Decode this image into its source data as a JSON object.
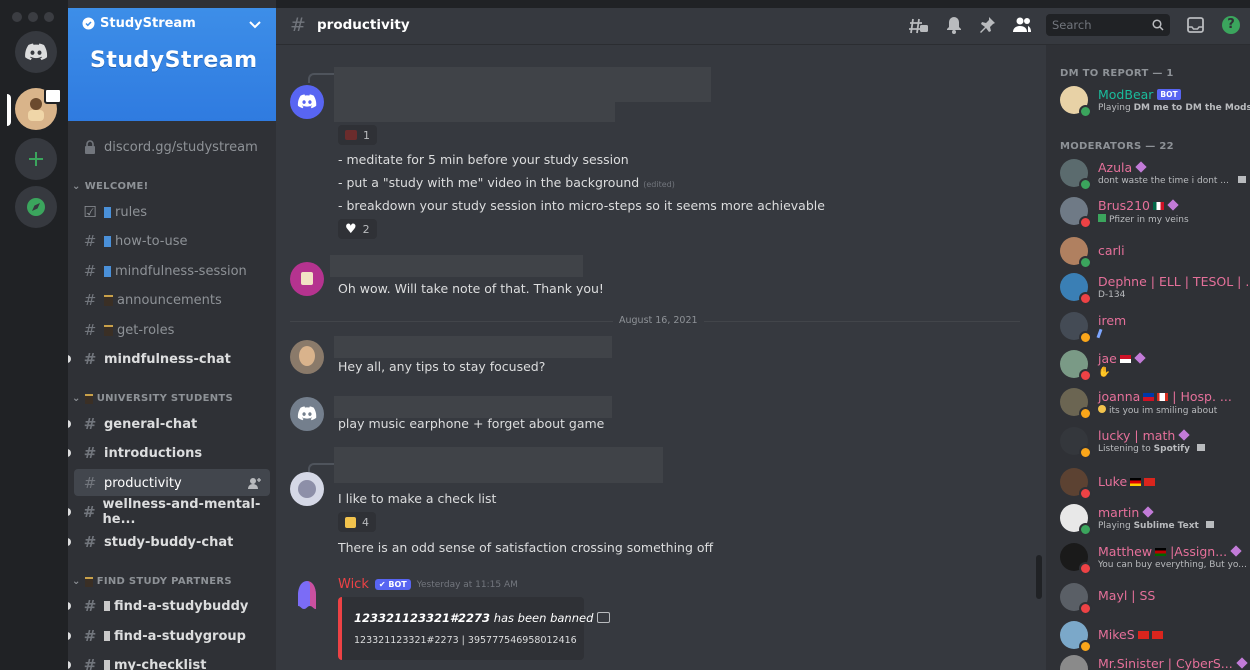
{
  "server": {
    "name": "StudyStream",
    "banner_text": "StudyStream",
    "invite": "discord.gg/studystream"
  },
  "sidebar": {
    "categories": [
      {
        "label": "WELCOME!"
      },
      {
        "label": "UNIVERSITY STUDENTS"
      },
      {
        "label": "FIND STUDY PARTNERS"
      }
    ],
    "channels": [
      {
        "label": "rules"
      },
      {
        "label": "how-to-use"
      },
      {
        "label": "mindfulness-session"
      },
      {
        "label": "announcements"
      },
      {
        "label": "get-roles"
      },
      {
        "label": "mindfulness-chat"
      },
      {
        "label": "general-chat"
      },
      {
        "label": "introductions"
      },
      {
        "label": "productivity"
      },
      {
        "label": "wellness-and-mental-he..."
      },
      {
        "label": "study-buddy-chat"
      },
      {
        "label": "find-a-studybuddy"
      },
      {
        "label": "find-a-studygroup"
      },
      {
        "label": "my-checklist"
      }
    ]
  },
  "header": {
    "channel": "productivity",
    "search_placeholder": "Search"
  },
  "messages": {
    "m1": {
      "reaction_count": "1",
      "lines": [
        "- meditate for 5 min before your study session",
        "- put a \"study with me\" video in the background",
        "- breakdown your study session into micro-steps so it seems more achievable"
      ],
      "edited": "(edited)",
      "heart_count": "2"
    },
    "m2": "Oh wow. Will take note of that. Thank you!",
    "date_divider": "August 16, 2021",
    "m3": "Hey all, any tips to stay focused?",
    "m4": "play music earphone + forget about game",
    "m5": {
      "text": "I like to make a check list",
      "thumbs_count": "4",
      "text2": "There is an odd sense of satisfaction crossing something off"
    },
    "m6": {
      "author": "Wick",
      "bot_tag": "BOT",
      "timestamp": "Yesterday at 11:15 AM",
      "embed_title_id": "123321123321#2273",
      "embed_title_rest": "has been banned",
      "embed_sub": "123321123321#2273 | 395777546958012416"
    }
  },
  "members": {
    "dm_header": "DM TO REPORT — 1",
    "mod_header": "MODERATORS — 22",
    "list": [
      {
        "name": "ModBear",
        "tag": "BOT",
        "sub_pre": "Playing ",
        "sub_bold": "DM me to DM the Mods"
      },
      {
        "name": "Azula",
        "sub": "dont waste the time i dont ..."
      },
      {
        "name": "Brus210",
        "sub": "Pfizer in my veins"
      },
      {
        "name": "carli"
      },
      {
        "name": "Dephne | ELL | TESOL | ...",
        "sub": "D-134"
      },
      {
        "name": "irem"
      },
      {
        "name": "jae"
      },
      {
        "name": "joanna",
        "name_rest": "| Hosp. ...",
        "sub": "its you im smiling about"
      },
      {
        "name": "lucky | math",
        "sub_pre": "Listening to ",
        "sub_bold": "Spotify"
      },
      {
        "name": "Luke"
      },
      {
        "name": "martin",
        "sub_pre": "Playing ",
        "sub_bold": "Sublime Text"
      },
      {
        "name": "Matthew",
        "name_rest": "|Assign...",
        "sub": "You can buy everything, But yo..."
      },
      {
        "name": "Mayl | SS"
      },
      {
        "name": "MikeS"
      },
      {
        "name": "Mr.Sinister | CyberS..."
      }
    ]
  },
  "colors": {
    "rail": "#202225",
    "sidebar": "#2f3136",
    "chat": "#36393f",
    "blurple": "#5865f2",
    "mod_pink": "#e5709a",
    "banner": "#3d8ee8",
    "bot_red": "#ed4245"
  }
}
